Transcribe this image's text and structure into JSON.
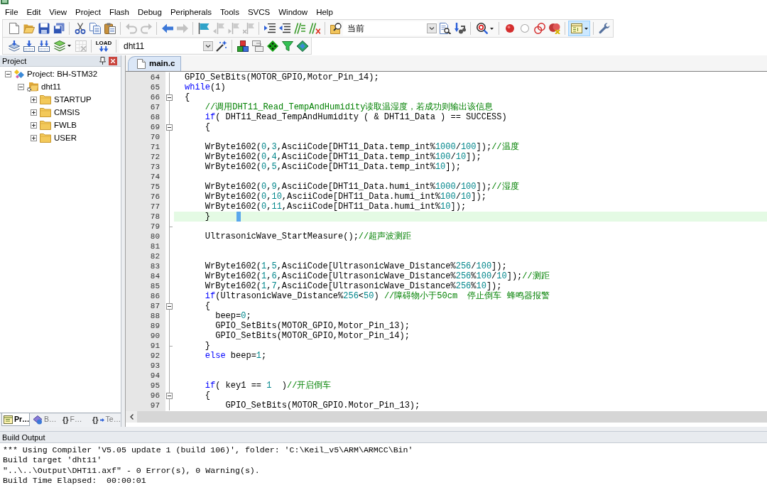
{
  "menu": [
    "File",
    "Edit",
    "View",
    "Project",
    "Flash",
    "Debug",
    "Peripherals",
    "Tools",
    "SVCS",
    "Window",
    "Help"
  ],
  "toolbar_1": [
    {
      "kind": "button",
      "disabled": false,
      "on": false
    },
    {
      "kind": "button",
      "disabled": false,
      "on": false
    },
    {
      "kind": "button",
      "disabled": false,
      "on": false
    },
    {
      "kind": "button",
      "disabled": false,
      "on": false
    },
    {
      "kind": "separator"
    },
    {
      "kind": "button",
      "disabled": false,
      "on": false
    },
    {
      "kind": "button",
      "disabled": false,
      "on": false
    },
    {
      "kind": "button",
      "disabled": false,
      "on": false
    },
    {
      "kind": "separator"
    },
    {
      "kind": "button",
      "disabled": true,
      "on": false
    },
    {
      "kind": "button",
      "disabled": true,
      "on": false
    },
    {
      "kind": "separator"
    },
    {
      "kind": "button",
      "disabled": false,
      "on": false
    },
    {
      "kind": "button",
      "disabled": true,
      "on": false
    },
    {
      "kind": "separator"
    },
    {
      "kind": "button",
      "disabled": false,
      "on": false
    },
    {
      "kind": "button",
      "disabled": true,
      "on": false
    },
    {
      "kind": "button",
      "disabled": true,
      "on": false
    },
    {
      "kind": "button",
      "disabled": true,
      "on": false
    },
    {
      "kind": "separator"
    },
    {
      "kind": "button",
      "disabled": false,
      "on": false
    },
    {
      "kind": "button",
      "disabled": false,
      "on": false
    },
    {
      "kind": "button",
      "disabled": false,
      "on": false
    },
    {
      "kind": "button",
      "disabled": false,
      "on": false
    },
    {
      "kind": "separator"
    },
    {
      "kind": "button",
      "disabled": false,
      "on": false
    },
    {
      "kind": "combobox",
      "value": "当前"
    },
    {
      "kind": "button",
      "disabled": false,
      "on": false
    },
    {
      "kind": "button",
      "disabled": false,
      "on": false
    },
    {
      "kind": "separator"
    },
    {
      "kind": "dropdown",
      "disabled": false,
      "on": false
    },
    {
      "kind": "separator"
    },
    {
      "kind": "button",
      "disabled": false,
      "on": false
    },
    {
      "kind": "button",
      "disabled": false,
      "on": false
    },
    {
      "kind": "button",
      "disabled": false,
      "on": false
    },
    {
      "kind": "button",
      "disabled": false,
      "on": false
    },
    {
      "kind": "separator"
    },
    {
      "kind": "dropdown",
      "disabled": false,
      "on": true
    },
    {
      "kind": "separator"
    },
    {
      "kind": "button",
      "disabled": false,
      "on": false
    }
  ],
  "toolbar_2": [
    {
      "kind": "button",
      "disabled": false,
      "on": false
    },
    {
      "kind": "button",
      "disabled": false,
      "on": false
    },
    {
      "kind": "button",
      "disabled": false,
      "on": false
    },
    {
      "kind": "dropdown",
      "disabled": false,
      "on": false
    },
    {
      "kind": "button",
      "disabled": true,
      "on": false
    },
    {
      "kind": "separator"
    },
    {
      "kind": "button",
      "label": "LOAD",
      "disabled": false,
      "on": false
    },
    {
      "kind": "separator"
    },
    {
      "kind": "combobox",
      "value": "dht11"
    },
    {
      "kind": "button",
      "disabled": false,
      "on": false
    },
    {
      "kind": "separator"
    },
    {
      "kind": "button",
      "disabled": false,
      "on": false
    },
    {
      "kind": "button",
      "disabled": false,
      "on": false
    },
    {
      "kind": "button",
      "disabled": false,
      "on": false
    },
    {
      "kind": "button",
      "disabled": false,
      "on": false
    },
    {
      "kind": "button",
      "disabled": false,
      "on": false
    }
  ],
  "project_panel": {
    "title": "Project",
    "tree": [
      {
        "kind": "project",
        "label": "Project: BH-STM32",
        "expanded": true,
        "children": [
          {
            "kind": "target",
            "label": "dht11",
            "expanded": true,
            "children": [
              {
                "kind": "group",
                "label": "STARTUP",
                "expanded": false
              },
              {
                "kind": "group",
                "label": "CMSIS",
                "expanded": false
              },
              {
                "kind": "group",
                "label": "FWLB",
                "expanded": false
              },
              {
                "kind": "group",
                "label": "USER",
                "expanded": false
              }
            ]
          }
        ]
      }
    ],
    "tabs": [
      {
        "label": "Pr…",
        "selected": true
      },
      {
        "label": "B…",
        "selected": false
      },
      {
        "label": "F…",
        "selected": false,
        "glyph": "{}"
      },
      {
        "label": "Te…",
        "selected": false,
        "glyph": "{}"
      }
    ]
  },
  "editor": {
    "tabs": [
      {
        "label": "main.c",
        "selected": true
      }
    ],
    "lines": [
      {
        "number": "64",
        "kind": "plain",
        "current": false,
        "segments": [
          {
            "kind": "plain",
            "text": "GPIO_SetBits(MOTOR_GPIO,Motor_Pin_14);"
          }
        ]
      },
      {
        "number": "65",
        "kind": "plain",
        "current": false,
        "segments": [
          {
            "kind": "keyword",
            "text": "while"
          },
          {
            "kind": "plain",
            "text": "(1)"
          }
        ]
      },
      {
        "number": "66",
        "kind": "opening",
        "current": false,
        "segments": [
          {
            "kind": "plain",
            "text": "{"
          }
        ]
      },
      {
        "number": "67",
        "kind": "plain",
        "current": false,
        "segments": [
          {
            "kind": "comment",
            "text": "    //调用DHT11_Read_TempAndHumidity读取温湿度，若成功则输出该信息"
          }
        ]
      },
      {
        "number": "68",
        "kind": "plain",
        "current": false,
        "segments": [
          {
            "kind": "keyword",
            "text": "    if"
          },
          {
            "kind": "plain",
            "text": "( DHT11_Read_TempAndHumidity ( & DHT11_Data ) == SUCCESS)"
          }
        ]
      },
      {
        "number": "69",
        "kind": "opening",
        "current": false,
        "segments": [
          {
            "kind": "plain",
            "text": "    {"
          }
        ]
      },
      {
        "number": "70",
        "kind": "plain",
        "current": false
      },
      {
        "number": "71",
        "kind": "plain",
        "current": false,
        "segments": [
          {
            "kind": "plain",
            "text": "    WrByte1602("
          },
          {
            "kind": "number",
            "text": "0"
          },
          {
            "kind": "plain",
            "text": ","
          },
          {
            "kind": "number",
            "text": "3"
          },
          {
            "kind": "plain",
            "text": ",AsciiCode[DHT11_Data.temp_int%"
          },
          {
            "kind": "number",
            "text": "1000"
          },
          {
            "kind": "plain",
            "text": "/"
          },
          {
            "kind": "number",
            "text": "100"
          },
          {
            "kind": "plain",
            "text": "]);"
          },
          {
            "kind": "comment",
            "text": "//温度"
          }
        ]
      },
      {
        "number": "72",
        "kind": "plain",
        "current": false,
        "segments": [
          {
            "kind": "plain",
            "text": "    WrByte1602("
          },
          {
            "kind": "number",
            "text": "0"
          },
          {
            "kind": "plain",
            "text": ","
          },
          {
            "kind": "number",
            "text": "4"
          },
          {
            "kind": "plain",
            "text": ",AsciiCode[DHT11_Data.temp_int%"
          },
          {
            "kind": "number",
            "text": "100"
          },
          {
            "kind": "plain",
            "text": "/"
          },
          {
            "kind": "number",
            "text": "10"
          },
          {
            "kind": "plain",
            "text": "]);"
          }
        ]
      },
      {
        "number": "73",
        "kind": "plain",
        "current": false,
        "segments": [
          {
            "kind": "plain",
            "text": "    WrByte1602("
          },
          {
            "kind": "number",
            "text": "0"
          },
          {
            "kind": "plain",
            "text": ","
          },
          {
            "kind": "number",
            "text": "5"
          },
          {
            "kind": "plain",
            "text": ",AsciiCode[DHT11_Data.temp_int%"
          },
          {
            "kind": "number",
            "text": "10"
          },
          {
            "kind": "plain",
            "text": "]);"
          }
        ]
      },
      {
        "number": "74",
        "kind": "plain",
        "current": false
      },
      {
        "number": "75",
        "kind": "plain",
        "current": false,
        "segments": [
          {
            "kind": "plain",
            "text": "    WrByte1602("
          },
          {
            "kind": "number",
            "text": "0"
          },
          {
            "kind": "plain",
            "text": ","
          },
          {
            "kind": "number",
            "text": "9"
          },
          {
            "kind": "plain",
            "text": ",AsciiCode[DHT11_Data.humi_int%"
          },
          {
            "kind": "number",
            "text": "1000"
          },
          {
            "kind": "plain",
            "text": "/"
          },
          {
            "kind": "number",
            "text": "100"
          },
          {
            "kind": "plain",
            "text": "]);"
          },
          {
            "kind": "comment",
            "text": "//湿度"
          }
        ]
      },
      {
        "number": "76",
        "kind": "plain",
        "current": false,
        "segments": [
          {
            "kind": "plain",
            "text": "    WrByte1602("
          },
          {
            "kind": "number",
            "text": "0"
          },
          {
            "kind": "plain",
            "text": ","
          },
          {
            "kind": "number",
            "text": "10"
          },
          {
            "kind": "plain",
            "text": ",AsciiCode[DHT11_Data.humi_int%"
          },
          {
            "kind": "number",
            "text": "100"
          },
          {
            "kind": "plain",
            "text": "/"
          },
          {
            "kind": "number",
            "text": "10"
          },
          {
            "kind": "plain",
            "text": "]);"
          }
        ]
      },
      {
        "number": "77",
        "kind": "plain",
        "current": false,
        "segments": [
          {
            "kind": "plain",
            "text": "    WrByte1602("
          },
          {
            "kind": "number",
            "text": "0"
          },
          {
            "kind": "plain",
            "text": ","
          },
          {
            "kind": "number",
            "text": "11"
          },
          {
            "kind": "plain",
            "text": ",AsciiCode[DHT11_Data.humi_int%"
          },
          {
            "kind": "number",
            "text": "10"
          },
          {
            "kind": "plain",
            "text": "]);"
          }
        ]
      },
      {
        "number": "78",
        "kind": "plain",
        "current": true,
        "segments": [
          {
            "kind": "plain",
            "text": "    }"
          }
        ]
      },
      {
        "number": "79",
        "kind": "closing",
        "current": false
      },
      {
        "number": "80",
        "kind": "plain",
        "current": false,
        "segments": [
          {
            "kind": "plain",
            "text": "    UltrasonicWave_StartMeasure();"
          },
          {
            "kind": "comment",
            "text": "//超声波测距"
          }
        ]
      },
      {
        "number": "81",
        "kind": "plain",
        "current": false
      },
      {
        "number": "82",
        "kind": "plain",
        "current": false
      },
      {
        "number": "83",
        "kind": "plain",
        "current": false,
        "segments": [
          {
            "kind": "plain",
            "text": "    WrByte1602("
          },
          {
            "kind": "number",
            "text": "1"
          },
          {
            "kind": "plain",
            "text": ","
          },
          {
            "kind": "number",
            "text": "5"
          },
          {
            "kind": "plain",
            "text": ",AsciiCode[UltrasonicWave_Distance%"
          },
          {
            "kind": "number",
            "text": "256"
          },
          {
            "kind": "plain",
            "text": "/"
          },
          {
            "kind": "number",
            "text": "100"
          },
          {
            "kind": "plain",
            "text": "]);"
          }
        ]
      },
      {
        "number": "84",
        "kind": "plain",
        "current": false,
        "segments": [
          {
            "kind": "plain",
            "text": "    WrByte1602("
          },
          {
            "kind": "number",
            "text": "1"
          },
          {
            "kind": "plain",
            "text": ","
          },
          {
            "kind": "number",
            "text": "6"
          },
          {
            "kind": "plain",
            "text": ",AsciiCode[UltrasonicWave_Distance%"
          },
          {
            "kind": "number",
            "text": "256"
          },
          {
            "kind": "plain",
            "text": "%"
          },
          {
            "kind": "number",
            "text": "100"
          },
          {
            "kind": "plain",
            "text": "/"
          },
          {
            "kind": "number",
            "text": "10"
          },
          {
            "kind": "plain",
            "text": "]);"
          },
          {
            "kind": "comment",
            "text": "//测距"
          }
        ]
      },
      {
        "number": "85",
        "kind": "plain",
        "current": false,
        "segments": [
          {
            "kind": "plain",
            "text": "    WrByte1602("
          },
          {
            "kind": "number",
            "text": "1"
          },
          {
            "kind": "plain",
            "text": ","
          },
          {
            "kind": "number",
            "text": "7"
          },
          {
            "kind": "plain",
            "text": ",AsciiCode[UltrasonicWave_Distance%"
          },
          {
            "kind": "number",
            "text": "256"
          },
          {
            "kind": "plain",
            "text": "%"
          },
          {
            "kind": "number",
            "text": "10"
          },
          {
            "kind": "plain",
            "text": "]);"
          }
        ]
      },
      {
        "number": "86",
        "kind": "plain",
        "current": false,
        "segments": [
          {
            "kind": "keyword",
            "text": "    if"
          },
          {
            "kind": "plain",
            "text": "(UltrasonicWave_Distance%"
          },
          {
            "kind": "number",
            "text": "256"
          },
          {
            "kind": "plain",
            "text": "<"
          },
          {
            "kind": "number",
            "text": "50"
          },
          {
            "kind": "plain",
            "text": ") "
          },
          {
            "kind": "comment",
            "text": "//障碍物小于50cm  停止倒车 蜂鸣器报警"
          }
        ]
      },
      {
        "number": "87",
        "kind": "opening",
        "current": false,
        "segments": [
          {
            "kind": "plain",
            "text": "    {"
          }
        ]
      },
      {
        "number": "88",
        "kind": "plain",
        "current": false,
        "segments": [
          {
            "kind": "plain",
            "text": "      beep="
          },
          {
            "kind": "number",
            "text": "0"
          },
          {
            "kind": "plain",
            "text": ";"
          }
        ]
      },
      {
        "number": "89",
        "kind": "plain",
        "current": false,
        "segments": [
          {
            "kind": "plain",
            "text": "      GPIO_SetBits(MOTOR_GPIO,Motor_Pin_13);"
          }
        ]
      },
      {
        "number": "90",
        "kind": "plain",
        "current": false,
        "segments": [
          {
            "kind": "plain",
            "text": "      GPIO_SetBits(MOTOR_GPIO,Motor_Pin_14);"
          }
        ]
      },
      {
        "number": "91",
        "kind": "closing",
        "current": false,
        "segments": [
          {
            "kind": "plain",
            "text": "    }"
          }
        ]
      },
      {
        "number": "92",
        "kind": "plain",
        "current": false,
        "segments": [
          {
            "kind": "keyword",
            "text": "    else"
          },
          {
            "kind": "plain",
            "text": " beep="
          },
          {
            "kind": "number",
            "text": "1"
          },
          {
            "kind": "plain",
            "text": ";"
          }
        ]
      },
      {
        "number": "93",
        "kind": "plain",
        "current": false
      },
      {
        "number": "94",
        "kind": "plain",
        "current": false
      },
      {
        "number": "95",
        "kind": "plain",
        "current": false,
        "segments": [
          {
            "kind": "keyword",
            "text": "    if"
          },
          {
            "kind": "plain",
            "text": "( key1 == "
          },
          {
            "kind": "number",
            "text": "1"
          },
          {
            "kind": "plain",
            "text": "  )"
          },
          {
            "kind": "comment",
            "text": "//开启倒车"
          }
        ]
      },
      {
        "number": "96",
        "kind": "opening",
        "current": false,
        "segments": [
          {
            "kind": "plain",
            "text": "    {"
          }
        ]
      },
      {
        "number": "97",
        "kind": "plain",
        "current": false,
        "segments": [
          {
            "kind": "plain",
            "text": "        GPIO_SetBits(MOTOR_GPIO.Motor_Pin_13);"
          }
        ]
      }
    ]
  },
  "build_output": {
    "title": "Build Output",
    "lines": [
      "*** Using Compiler 'V5.05 update 1 (build 106)', folder: 'C:\\Keil_v5\\ARM\\ARMCC\\Bin'",
      "Build target 'dht11'",
      "\"..\\..\\Output\\DHT11.axf\" - 0 Error(s), 0 Warning(s).",
      "Build Time Elapsed:  00:00:01"
    ]
  }
}
